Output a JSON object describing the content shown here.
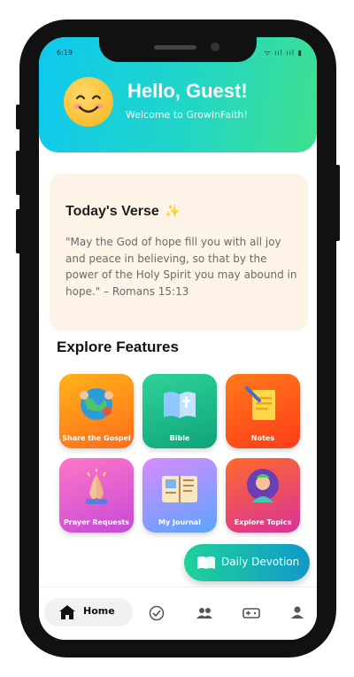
{
  "status_bar": {
    "time": "6:19",
    "indicators": "ᯤ ııl ııl ▮"
  },
  "header": {
    "greeting": "Hello, Guest!",
    "subtitle": "Welcome to GrowInFaith!",
    "avatar": "smiling-face"
  },
  "verse": {
    "title": "Today's Verse",
    "title_icon": "✨",
    "text": "\"May the God of hope fill you with all joy and peace in believing, so that by the power of the Holy Spirit you may abound in hope.\" – Romans 15:13"
  },
  "explore": {
    "title": "Explore Features",
    "tiles": [
      {
        "label": "Share the Gospel",
        "icon": "globe-people-icon",
        "colors": [
          "#ffb21a",
          "#ff6d1a"
        ]
      },
      {
        "label": "Bible",
        "icon": "bible-book-icon",
        "colors": [
          "#2fd39a",
          "#0fa37a"
        ]
      },
      {
        "label": "Notes",
        "icon": "notes-icon",
        "colors": [
          "#ff7a1a",
          "#ff3c1a"
        ]
      },
      {
        "label": "Prayer Requests",
        "icon": "praying-hands-icon",
        "colors": [
          "#ff76c6",
          "#c54ad8"
        ]
      },
      {
        "label": "My Journal",
        "icon": "journal-icon",
        "colors": [
          "#d78bff",
          "#5aa4ff"
        ]
      },
      {
        "label": "Explore Topics",
        "icon": "meditating-person-icon",
        "colors": [
          "#ff6a2a",
          "#d8329a"
        ]
      }
    ]
  },
  "fab": {
    "label": "Daily Devotion",
    "icon": "open-book-icon"
  },
  "tabbar": {
    "home_label": "Home",
    "icons": [
      "home-icon",
      "check-circle-icon",
      "people-icon",
      "gamepad-icon",
      "person-icon"
    ]
  }
}
